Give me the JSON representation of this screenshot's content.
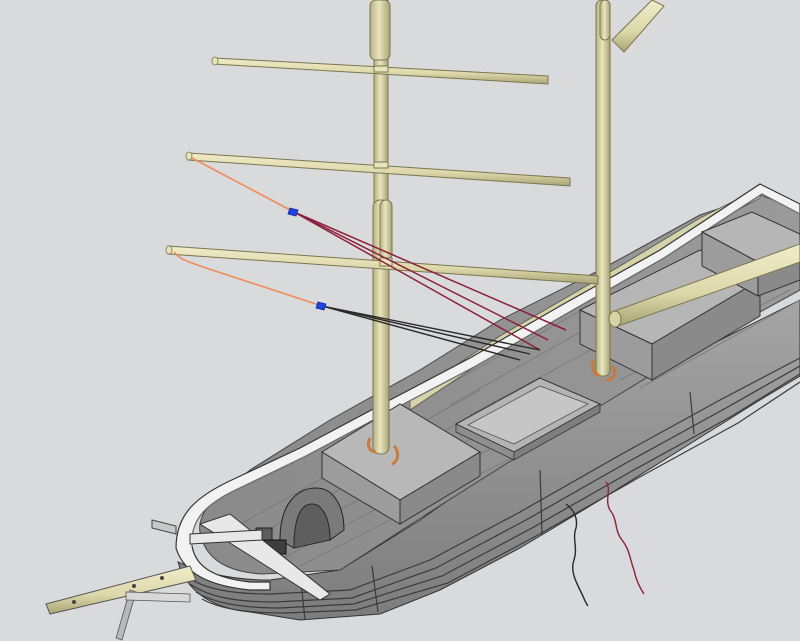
{
  "viewport": {
    "background": "#d9dadb"
  },
  "model": {
    "spar_color": "#e1dcae",
    "spar_shade": "#a9a476",
    "hull_color": "#9a9a9a",
    "deck_color": "#8f8f8f",
    "bulwark_inner": "#d6d3a9",
    "rail_color": "#f2f2f2",
    "plank_color": "#3a3a3a",
    "cabin_top": "#b5b5b5",
    "cabin_side": "#9c9c9c",
    "brace_color": "#c97a3c",
    "rigging_orange": "#f08a5a",
    "rigging_maroon": "#8c1f3c",
    "rigging_black": "#2a2a2a",
    "fitting_color": "#1e45e0"
  },
  "icons": {
    "rope_end_marker": "pin-icon"
  }
}
